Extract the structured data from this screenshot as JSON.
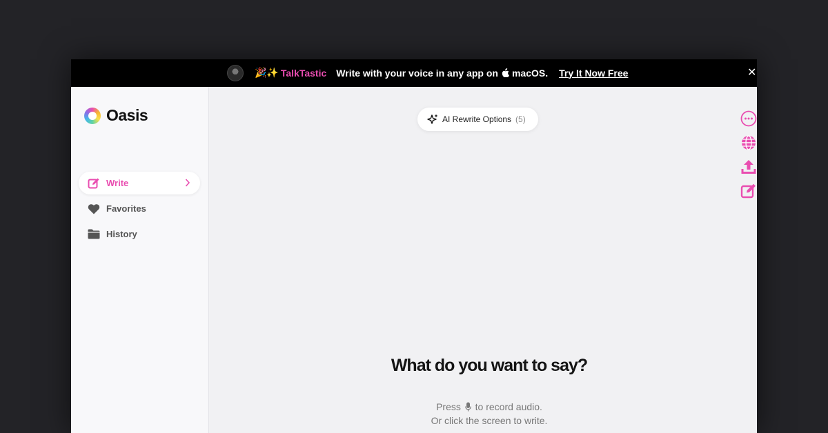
{
  "banner": {
    "emoji": "🎉✨",
    "brand": "TalkTastic",
    "message_prefix": "Write with your voice in any app on",
    "platform": "macOS.",
    "cta": "Try It Now Free",
    "close": "✕"
  },
  "app": {
    "name": "Oasis"
  },
  "sidebar": {
    "items": [
      {
        "label": "Write",
        "icon": "edit-icon",
        "active": true
      },
      {
        "label": "Favorites",
        "icon": "heart-icon",
        "active": false
      },
      {
        "label": "History",
        "icon": "folder-icon",
        "active": false
      }
    ]
  },
  "main": {
    "rewrite_label": "AI Rewrite Options",
    "rewrite_count": "(5)",
    "headline": "What do you want to say?",
    "hint_press": "Press",
    "hint_record": "to record audio.",
    "hint_click": "Or click the screen to write."
  },
  "toolbar": [
    "more-icon",
    "globe-icon",
    "upload-icon",
    "edit-icon"
  ],
  "colors": {
    "accent": "#e94db0",
    "banner_bg": "#000000",
    "page_bg": "#232327",
    "canvas_bg": "#f1f1f3"
  }
}
